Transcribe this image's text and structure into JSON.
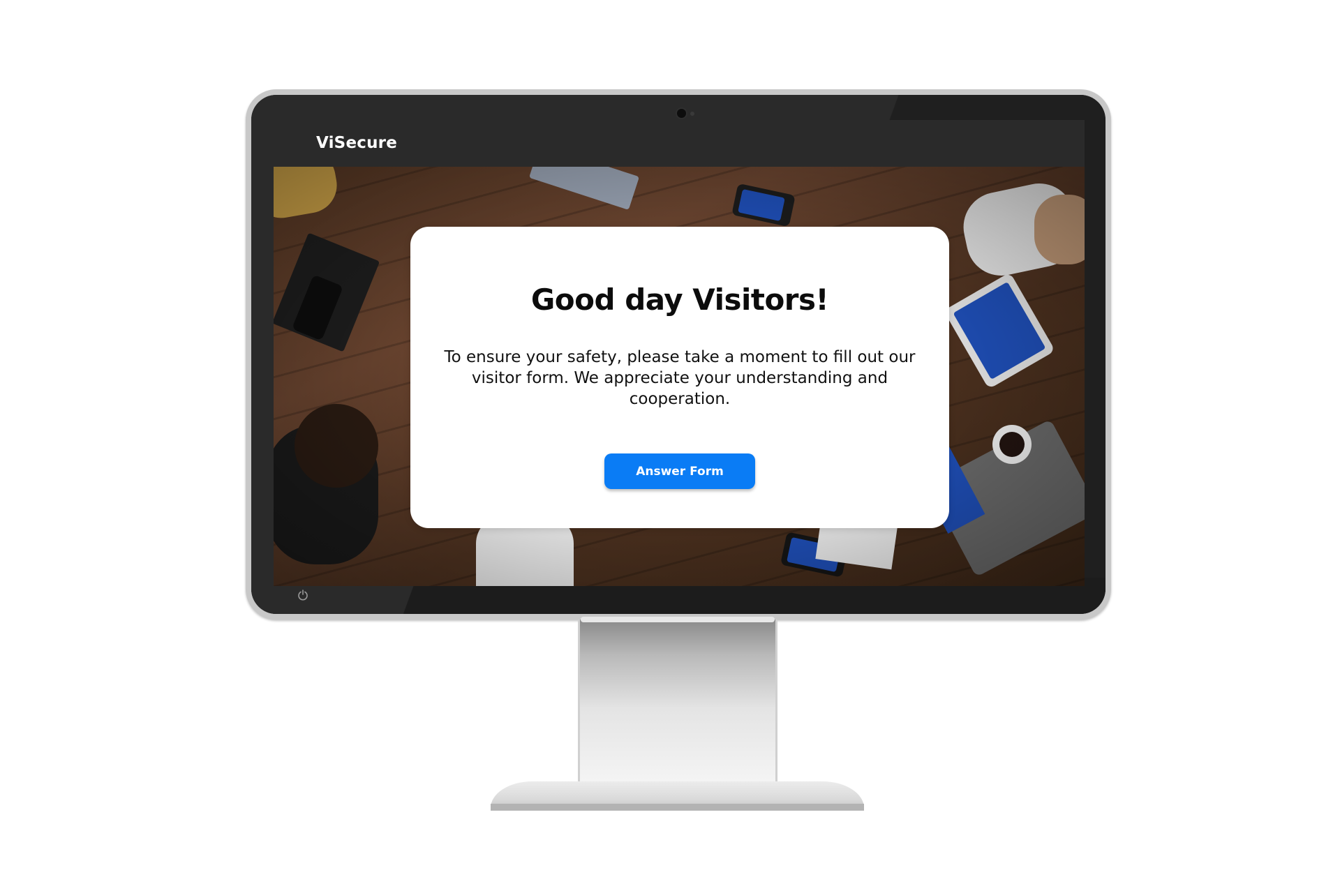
{
  "app": {
    "brand": "ViSecure"
  },
  "modal": {
    "title": "Good day Visitors!",
    "message": "To ensure your safety, please take a moment to fill out our visitor form. We appreciate your understanding and cooperation.",
    "button_label": "Answer Form"
  },
  "colors": {
    "button": "#0a7cf5",
    "header": "#2a2a2a",
    "card": "#ffffff"
  },
  "icons": {
    "power": "power-icon",
    "camera": "webcam-icon"
  }
}
